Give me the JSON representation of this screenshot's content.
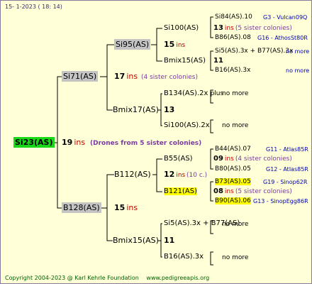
{
  "header": {
    "date": "15-   1-2023  ( 18:  14)"
  },
  "footer": {
    "copyright": "Copyright 2004-2023 @ Karl Kehrle Foundation",
    "site": "www.pedigreeapis.org"
  },
  "root": {
    "name": "Si23(AS)",
    "gen": "19",
    "ins": "ins",
    "sisters": "(Drones from 5 sister colonies)"
  },
  "sire": {
    "name": "Si71(AS)",
    "gen": "17",
    "ins": "ins",
    "sisters": "(4 sister colonies)"
  },
  "dam": {
    "name": "B128(AS)",
    "gen": "15",
    "ins": "ins"
  },
  "ss": {
    "name": "Si95(AS)",
    "gen": "15",
    "ins": "ins"
  },
  "sd": {
    "name": "Bmix17(AS)",
    "gen": "13"
  },
  "ds": {
    "name": "B112(AS)",
    "gen": "12",
    "ins": "ins",
    "sisters": "(10 c.)"
  },
  "dd": {
    "name": "Bmix15(AS)",
    "gen": "11"
  },
  "sss": {
    "name": "Si100(AS)",
    "gen": "13",
    "ins": "ins",
    "sisters": "(5 sister colonies)"
  },
  "ssd": {
    "name": "Bmix15(AS)",
    "gen": "11"
  },
  "sds": {
    "name": "B134(AS).2x",
    "note": "plus",
    "nomore": "no more"
  },
  "sdd": {
    "name": "Si100(AS).2x",
    "nomore": "no more"
  },
  "dss": {
    "name": "B55(AS)",
    "gen": "09",
    "ins": "ins",
    "sisters": "(4 sister colonies)"
  },
  "dsd": {
    "name": "B121(AS)",
    "gen": "08",
    "ins": "ins",
    "sisters": "(5 sister colonies)"
  },
  "dds": {
    "name": "Si5(AS).3x + B77(AS)",
    "nomore": "no more"
  },
  "ddd": {
    "name": "B16(AS).3x",
    "nomore": "no more"
  },
  "l4": [
    {
      "name": "Si84(AS).10",
      "code": "G3 - Vulcan09Q"
    },
    {
      "name": "B86(AS).08",
      "code": "G16 - AthosSt80R"
    },
    {
      "name": "Si5(AS).3x + B77(AS).3x",
      "code": "no more"
    },
    {
      "name": "B16(AS).3x",
      "code": "no more"
    },
    {
      "name": "B44(AS).07",
      "code": "G11 - Atlas85R"
    },
    {
      "name": "B80(AS).05",
      "code": "G12 - Atlas85R"
    },
    {
      "name": "B73(AS).05",
      "code": "G19 - Sinop62R"
    },
    {
      "name": "B90(AS).06",
      "code": "G13 - SinopEgg86R"
    }
  ],
  "colors": {
    "background": "#ffffd8",
    "root_bg": "#18d818",
    "grey_bg": "#c4c4c4",
    "highlight": "#ffff00",
    "ins_red": "#c40000",
    "code_blue": "#0000b8",
    "note_purple": "#7a3aa0",
    "footer_green": "#006000"
  }
}
